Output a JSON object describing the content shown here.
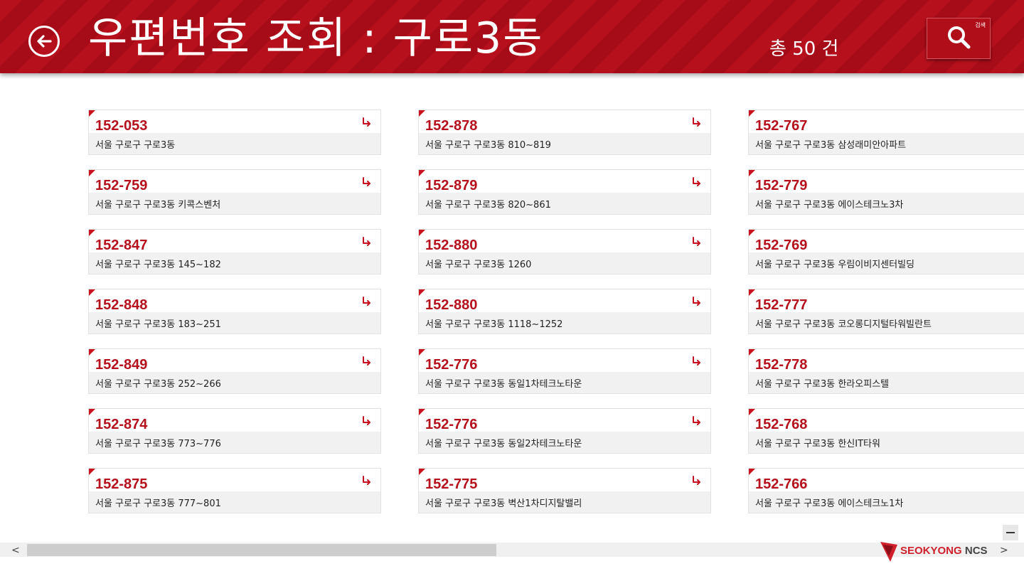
{
  "header": {
    "title": "우편번호 조회 : 구로3동",
    "total": "총 50 건",
    "search_tiny_label": "검색"
  },
  "results": [
    {
      "code": "152-053",
      "address": "서울 구로구 구로3동"
    },
    {
      "code": "152-878",
      "address": "서울 구로구 구로3동 810~819"
    },
    {
      "code": "152-767",
      "address": "서울 구로구 구로3동 삼성래미안아파트"
    },
    {
      "code": "152-759",
      "address": "서울 구로구 구로3동 키콕스벤처"
    },
    {
      "code": "152-879",
      "address": "서울 구로구 구로3동 820~861"
    },
    {
      "code": "152-779",
      "address": "서울 구로구 구로3동 에이스테크노3차"
    },
    {
      "code": "152-847",
      "address": "서울 구로구 구로3동  145~182"
    },
    {
      "code": "152-880",
      "address": "서울 구로구 구로3동 1260"
    },
    {
      "code": "152-769",
      "address": "서울 구로구 구로3동 우림이비지센터빌딩"
    },
    {
      "code": "152-848",
      "address": "서울 구로구 구로3동 183~251"
    },
    {
      "code": "152-880",
      "address": "서울 구로구 구로3동 1118~1252"
    },
    {
      "code": "152-777",
      "address": "서울 구로구 구로3동 코오롱디지털타워빌란트"
    },
    {
      "code": "152-849",
      "address": "서울 구로구 구로3동 252~266"
    },
    {
      "code": "152-776",
      "address": "서울 구로구 구로3동 동일1차테크노타운"
    },
    {
      "code": "152-778",
      "address": "서울 구로구 구로3동 한라오피스텔"
    },
    {
      "code": "152-874",
      "address": "서울 구로구 구로3동 773~776"
    },
    {
      "code": "152-776",
      "address": "서울 구로구 구로3동 동일2차테크노타운"
    },
    {
      "code": "152-768",
      "address": "서울 구로구 구로3동 한신IT타워"
    },
    {
      "code": "152-875",
      "address": "서울 구로구 구로3동 777~801"
    },
    {
      "code": "152-775",
      "address": "서울 구로구 구로3동 벽산1차디지탈밸리"
    },
    {
      "code": "152-766",
      "address": "서울 구로구 구로3동 에이스테크노1차"
    }
  ],
  "footer": {
    "logo_brand": "SEOKYONG",
    "logo_suffix": "NCS",
    "scroll_left_glyph": "<",
    "scroll_right_glyph": ">"
  },
  "colors": {
    "accent": "#b5101c",
    "card_bg": "#f1f1f1"
  }
}
